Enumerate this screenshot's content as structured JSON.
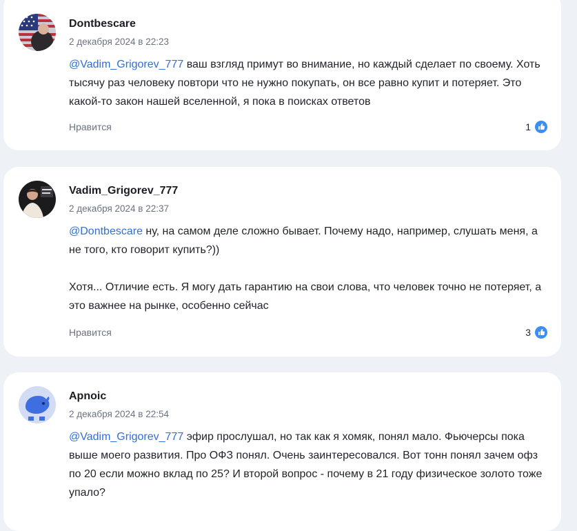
{
  "comments": [
    {
      "author": "Dontbescare",
      "date": "2 декабря 2024 в 22:23",
      "mention": "@Vadim_Grigorev_777",
      "paragraphs": [
        " ваш взгляд примут во внимание, но каждый сделает по своему. Хоть тысячу раз человеку повтори что не нужно покупать, он все равно купит и потеряет. Это какой-то закон нашей вселенной, я пока в поисках ответов"
      ],
      "like_label": "Нравится",
      "likes": "1",
      "avatar_icon": "flag-avatar"
    },
    {
      "author": "Vadim_Grigorev_777",
      "date": "2 декабря 2024 в 22:37",
      "mention": "@Dontbescare",
      "paragraphs": [
        " ну, на самом деле сложно бывает. Почему надо, например, слушать меня, а не того, кто говорит купить?))",
        "Хотя... Отличие есть. Я могу дать гарантию на свои слова, что человек точно не потеряет, а это важнее на рынке, особенно сейчас"
      ],
      "like_label": "Нравится",
      "likes": "3",
      "avatar_icon": "person-photo-avatar"
    },
    {
      "author": "Apnoic",
      "date": "2 декабря 2024 в 22:54",
      "mention": "@Vadim_Grigorev_777",
      "paragraphs": [
        " эфир прослушал, но так как я хомяк, понял мало. Фьючерсы пока выше моего развития. Про ОФЗ понял. Очень заинтересовался. Вот тонн понял зачем офз по 20 если можно вклад по 25? И второй вопрос - почему в 21 году физическое золото тоже упало?"
      ],
      "avatar_icon": "capybara-avatar"
    }
  ],
  "colors": {
    "background": "#eef1f5",
    "card": "#ffffff",
    "mention": "#2f6fdb",
    "like_badge": "#3a8ff0",
    "muted": "#6b7280"
  }
}
